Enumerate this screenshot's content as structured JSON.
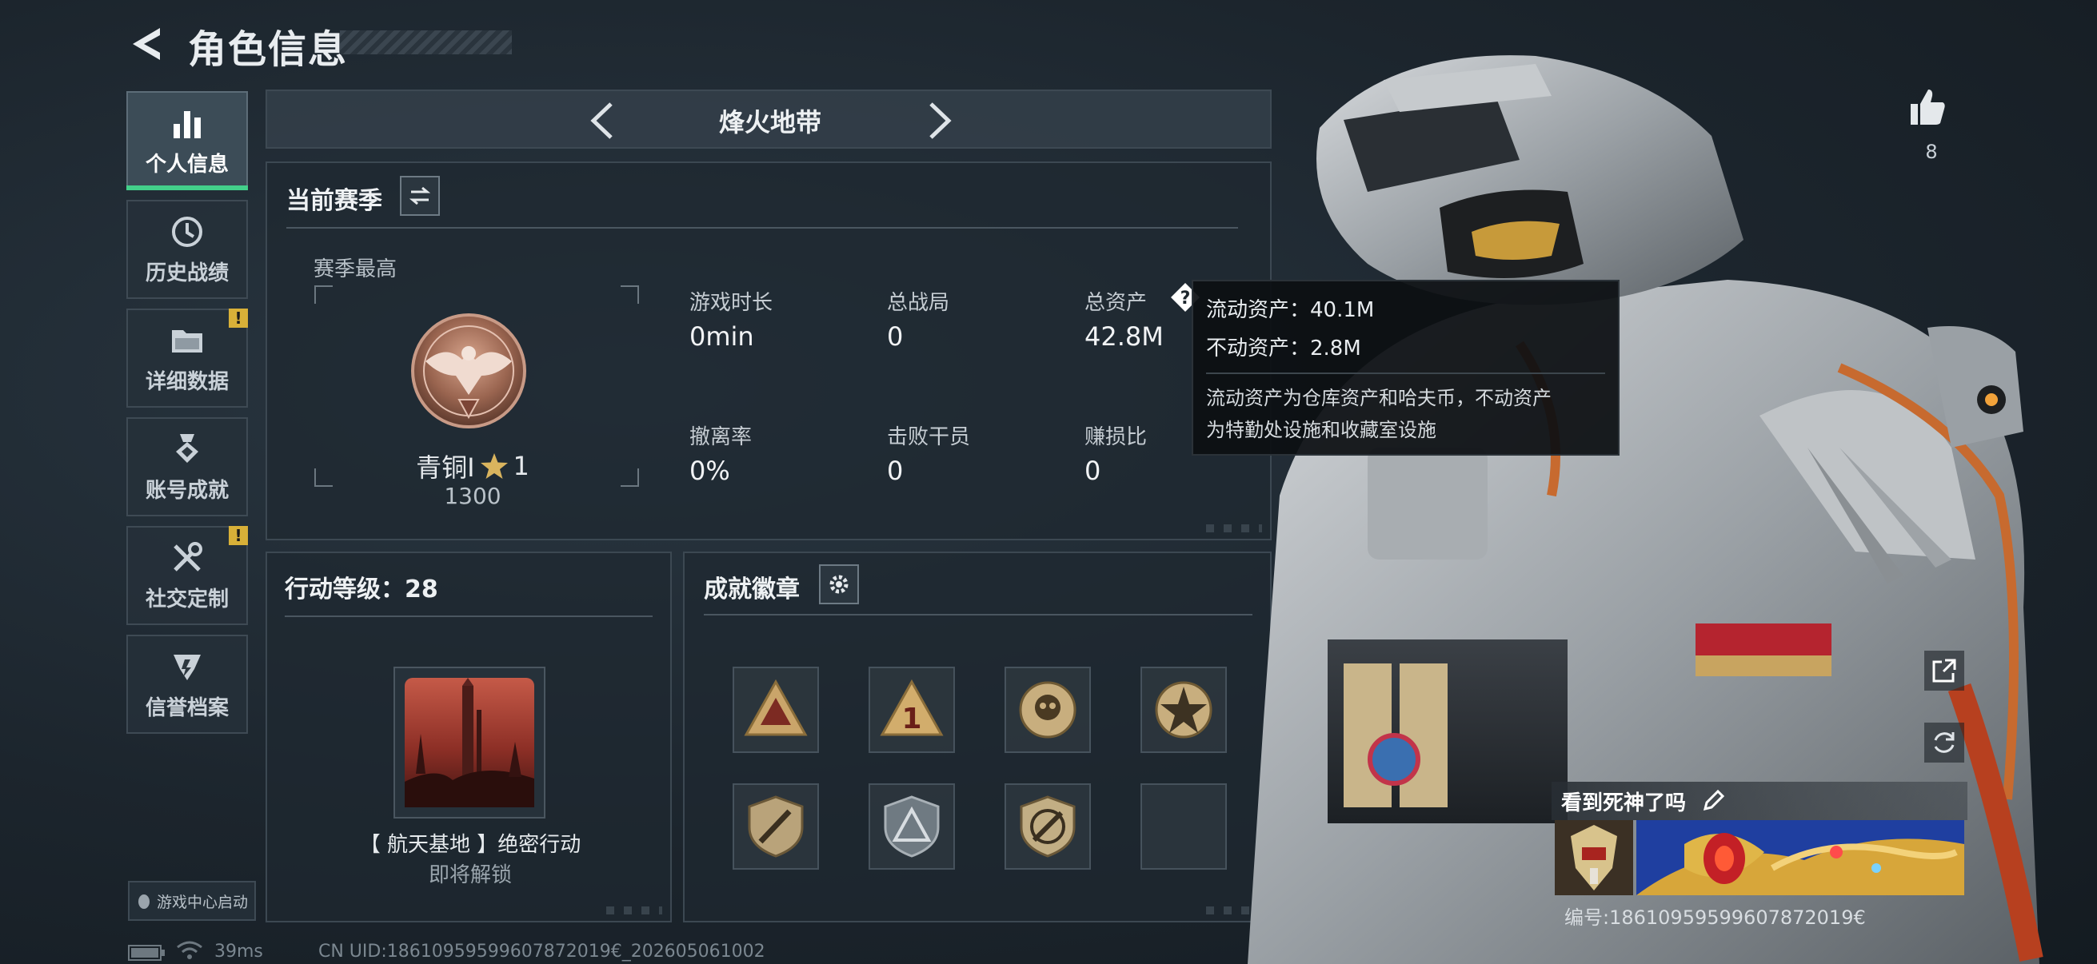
{
  "header": {
    "title": "角色信息"
  },
  "nav": {
    "items": [
      {
        "label": "个人信息",
        "icon": "bar-chart-icon",
        "active": true,
        "alert": false
      },
      {
        "label": "历史战绩",
        "icon": "history-icon",
        "active": false,
        "alert": false
      },
      {
        "label": "详细数据",
        "icon": "folder-icon",
        "active": false,
        "alert": true
      },
      {
        "label": "账号成就",
        "icon": "medal-icon",
        "active": false,
        "alert": false
      },
      {
        "label": "社交定制",
        "icon": "tools-icon",
        "active": false,
        "alert": true
      },
      {
        "label": "信誉档案",
        "icon": "credit-badge-icon",
        "active": false,
        "alert": false
      }
    ],
    "alert_mark": "!",
    "game_center_label": "游戏中心启动"
  },
  "mode_bar": {
    "name": "烽火地带"
  },
  "season": {
    "title": "当前赛季",
    "best_label": "赛季最高",
    "rank_name": "青铜Ⅰ",
    "rank_stars": "1",
    "rank_points": "1300",
    "stats": [
      {
        "label": "游戏时长",
        "value": "0min"
      },
      {
        "label": "总战局",
        "value": "0"
      },
      {
        "label": "总资产",
        "value": "42.8M"
      },
      {
        "label": "撤离率",
        "value": "0%"
      },
      {
        "label": "击败干员",
        "value": "0"
      },
      {
        "label": "赚损比",
        "value": "0"
      }
    ]
  },
  "tooltip": {
    "liquid": "流动资产：40.1M",
    "fixed": "不动资产：2.8M",
    "desc_line1": "流动资产为仓库资产和哈夫币，不动资产",
    "desc_line2": "为特勤处设施和收藏室设施"
  },
  "level": {
    "title": "行动等级：28",
    "map_name": "【 航天基地 】绝密行动",
    "map_status": "即将解锁"
  },
  "badges": {
    "title": "成就徽章",
    "slots": [
      "triangle-badge-icon",
      "rank-one-badge-icon",
      "skull-badge-icon",
      "star-badge-icon",
      "shield-knife-badge-icon",
      "shield-triangle-badge-icon",
      "shield-knife-badge-icon",
      "empty"
    ]
  },
  "likes": {
    "count": "8"
  },
  "name_card": {
    "name": "看到死神了吗",
    "id_text": "编号:18610959599607872019€"
  },
  "footer": {
    "ping": "39ms",
    "uid": "CN UID:18610959599607872019€_202605061002"
  },
  "colors": {
    "accent_green": "#43d08a",
    "alert_yellow": "#d8b038",
    "panel_border": "#3c4852"
  }
}
